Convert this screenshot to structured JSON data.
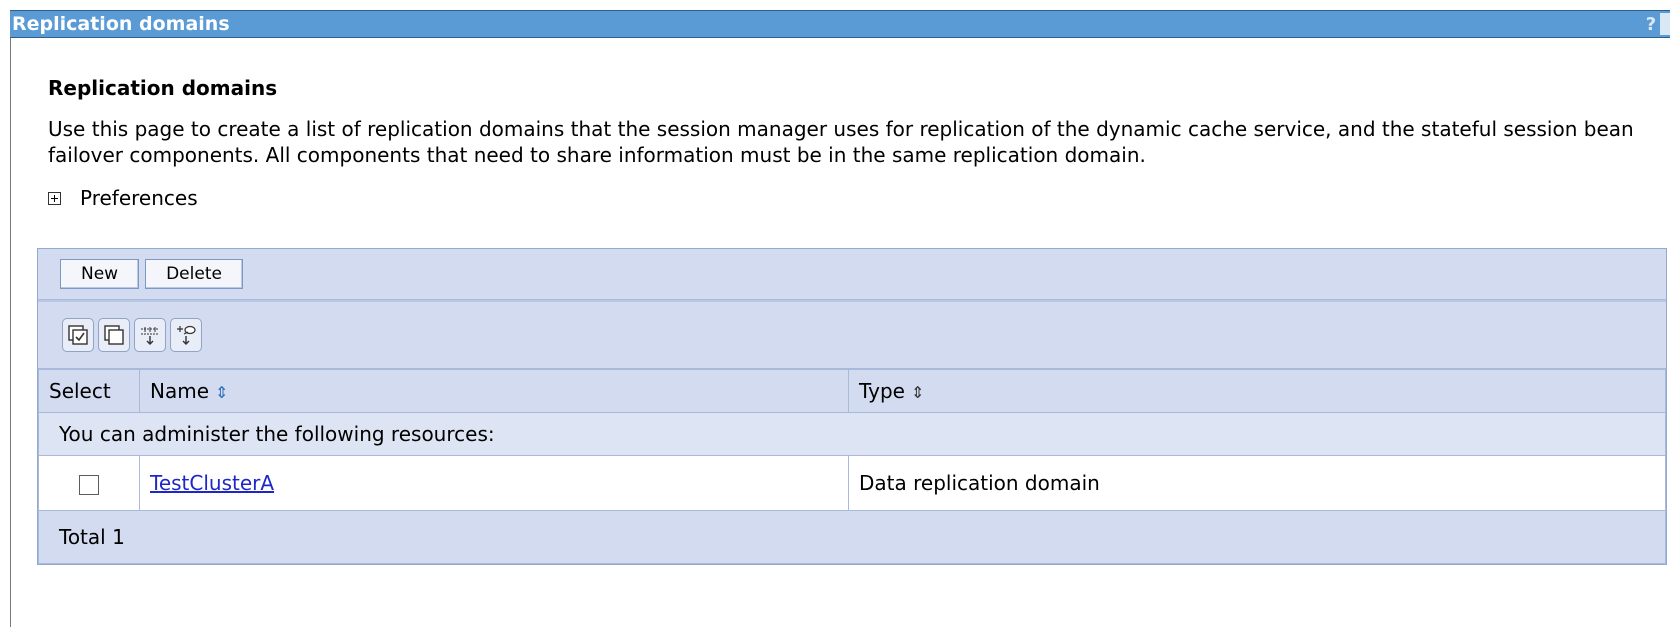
{
  "window": {
    "title": "Replication domains",
    "help_glyph": "?"
  },
  "page": {
    "heading": "Replication domains",
    "description": "Use this page to create a list of replication domains that the session manager uses for replication of the dynamic cache service, and the stateful session bean failover components. All components that need to share information must be in the same replication domain.",
    "preferences_label": "Preferences"
  },
  "toolbar": {
    "new_label": "New",
    "delete_label": "Delete"
  },
  "icon_toolbar": [
    "select-all-icon",
    "deselect-all-icon",
    "show-filter-icon",
    "clear-filter-icon"
  ],
  "table": {
    "headers": {
      "select": "Select",
      "name": "Name",
      "type": "Type"
    },
    "info_row": "You can administer the following resources:",
    "rows": [
      {
        "name": "TestClusterA",
        "type": "Data replication domain",
        "selected": false
      }
    ],
    "total": "Total 1"
  },
  "colors": {
    "titlebar": "#5b9bd5",
    "table_bg": "#d3dbf0",
    "link": "#1d27c9"
  }
}
